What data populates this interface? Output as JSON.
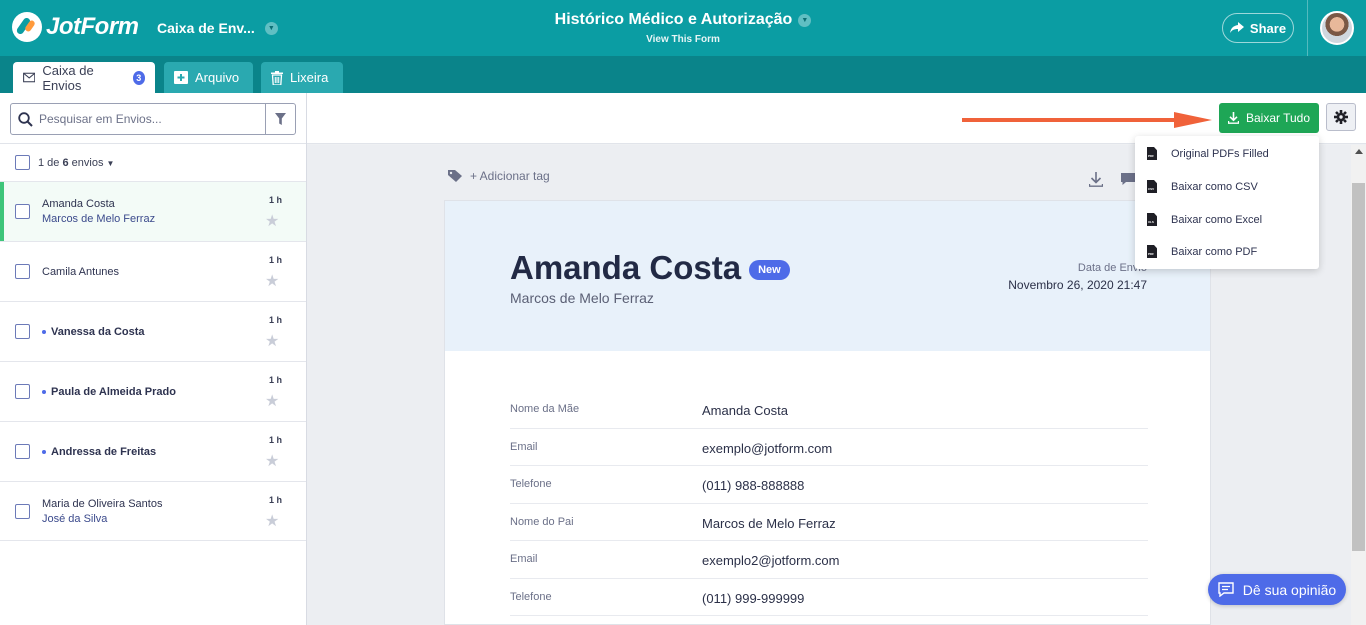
{
  "header": {
    "logo_text": "JotForm",
    "inbox_selector": "Caixa de Env...",
    "form_title": "Histórico Médico e Autorização",
    "form_subtitle": "View This Form",
    "share_label": "Share"
  },
  "tabs": [
    {
      "label": "Caixa de Envios",
      "badge": "3",
      "icon": "envelope-icon"
    },
    {
      "label": "Arquivo",
      "icon": "archive-icon"
    },
    {
      "label": "Lixeira",
      "icon": "trash-icon"
    }
  ],
  "search": {
    "placeholder": "Pesquisar em Envios..."
  },
  "list_header": {
    "prefix": "1 de ",
    "count": "6",
    "suffix": " envios"
  },
  "submissions": [
    {
      "name": "Amanda Costa",
      "sub": "Marcos de Melo Ferraz",
      "time": "1 h",
      "unread": false,
      "selected": true
    },
    {
      "name": "Camila Antunes",
      "sub": "",
      "time": "1 h",
      "unread": false,
      "selected": false
    },
    {
      "name": "Vanessa da Costa",
      "sub": "",
      "time": "1 h",
      "unread": true,
      "selected": false
    },
    {
      "name": "Paula de Almeida Prado",
      "sub": "",
      "time": "1 h",
      "unread": true,
      "selected": false
    },
    {
      "name": "Andressa de Freitas",
      "sub": "",
      "time": "1 h",
      "unread": true,
      "selected": false
    },
    {
      "name": "Maria de Oliveira Santos",
      "sub": "José da Silva",
      "time": "1 h",
      "unread": false,
      "selected": false
    }
  ],
  "toolbar": {
    "download_all_label": "Baixar Tudo",
    "add_tag_label": "+ Adicionar tag"
  },
  "download_menu": [
    {
      "label": "Original PDFs Filled",
      "icon": "pdf-file-icon",
      "tag": "PDF"
    },
    {
      "label": "Baixar como CSV",
      "icon": "csv-file-icon",
      "tag": "CSV"
    },
    {
      "label": "Baixar como Excel",
      "icon": "xls-file-icon",
      "tag": "XLS"
    },
    {
      "label": "Baixar como PDF",
      "icon": "pdf-file-icon",
      "tag": "PDF"
    }
  ],
  "submission_detail": {
    "name": "Amanda Costa",
    "badge": "New",
    "sender": "Marcos de Melo Ferraz",
    "date_label": "Data de Envio",
    "date_value": "Novembro 26, 2020 21:47",
    "fields": [
      {
        "label": "Nome da Mãe",
        "value": "Amanda Costa"
      },
      {
        "label": "Email",
        "value": "exemplo@jotform.com"
      },
      {
        "label": "Telefone",
        "value": "(011) 988-888888"
      },
      {
        "label": "Nome do Pai",
        "value": "Marcos de Melo Ferraz"
      },
      {
        "label": "Email",
        "value": "exemplo2@jotform.com"
      },
      {
        "label": "Telefone",
        "value": "(011) 999-999999"
      }
    ]
  },
  "feedback_label": "Dê sua opinião",
  "colors": {
    "brand_teal": "#0b9da3",
    "tab_bar": "#0a848a",
    "download_green": "#1ea656",
    "accent_blue": "#4e6be8",
    "arrow_orange": "#f0623a"
  }
}
